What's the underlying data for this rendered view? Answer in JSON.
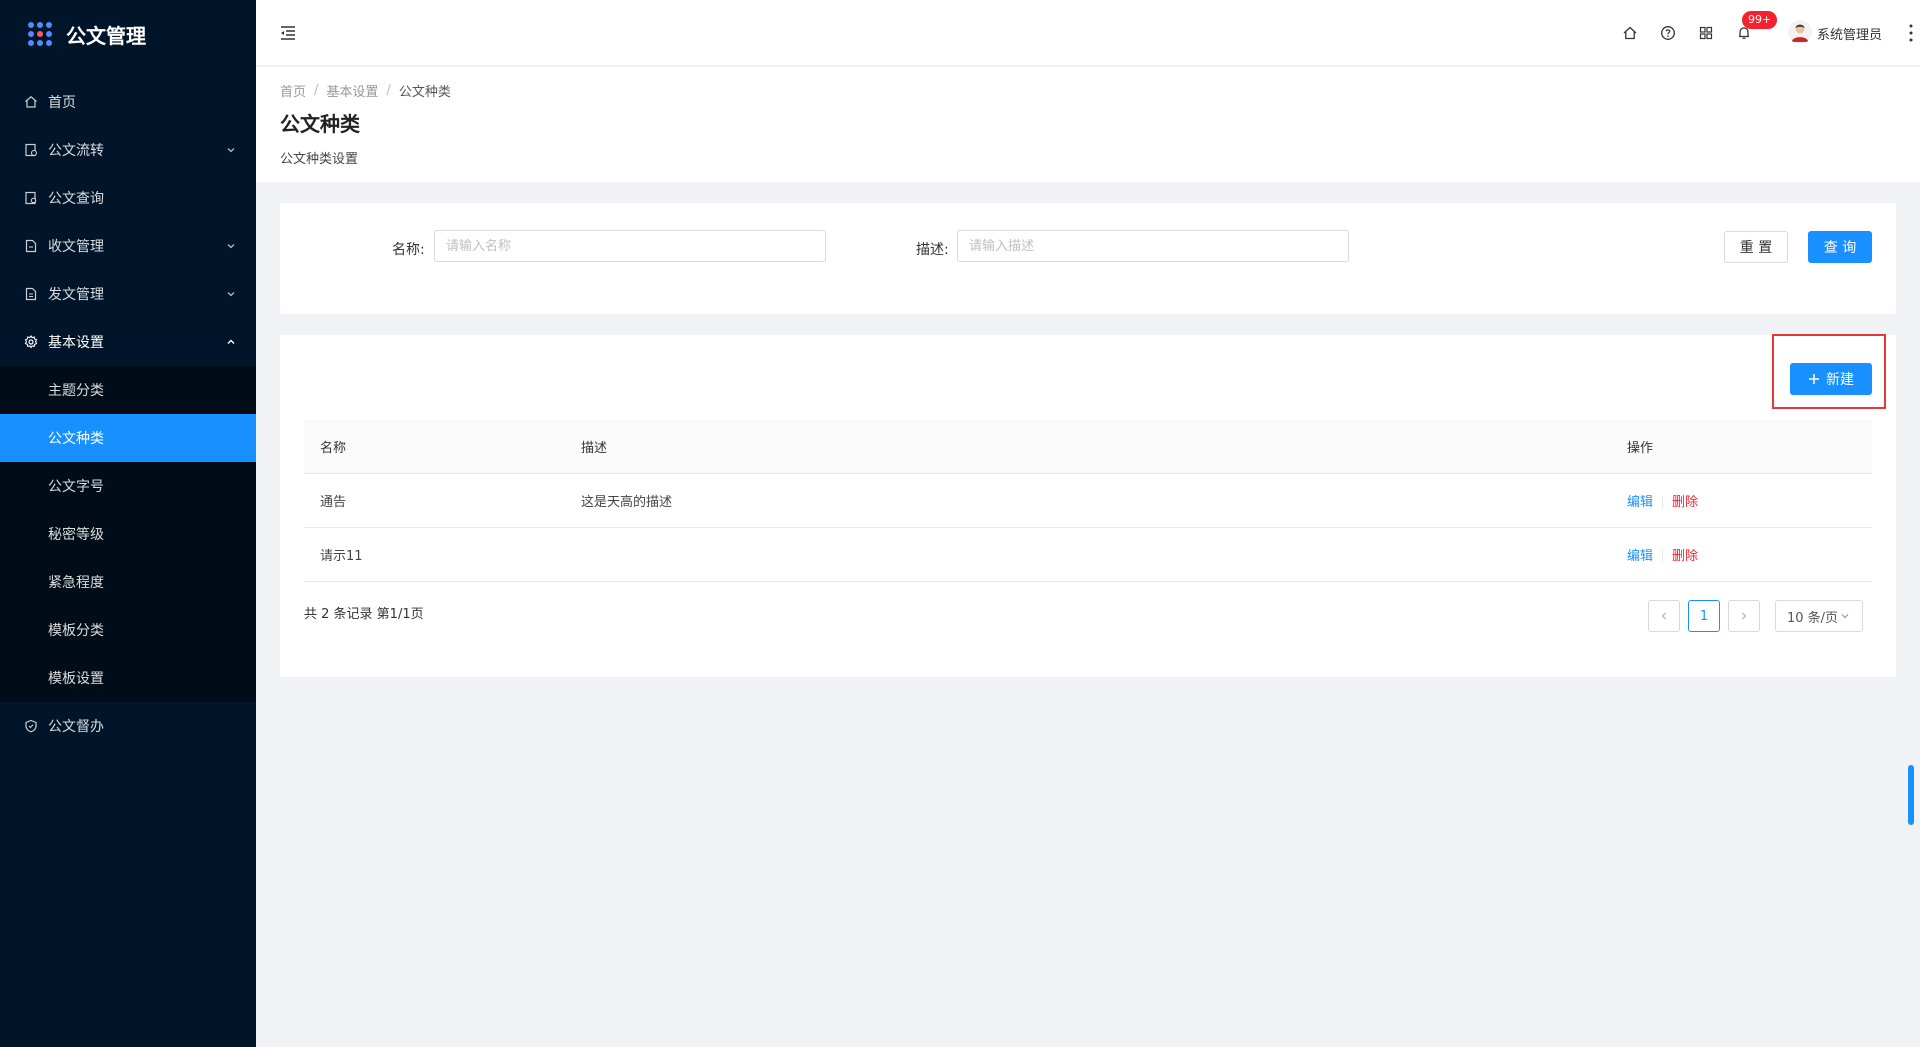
{
  "app": {
    "title": "公文管理"
  },
  "sidebar": {
    "items": [
      {
        "label": "首页",
        "icon": "home-icon"
      },
      {
        "label": "公文流转",
        "icon": "flow-icon",
        "expandable": true
      },
      {
        "label": "公文查询",
        "icon": "search-doc-icon"
      },
      {
        "label": "收文管理",
        "icon": "file-in-icon",
        "expandable": true
      },
      {
        "label": "发文管理",
        "icon": "file-out-icon",
        "expandable": true
      },
      {
        "label": "基本设置",
        "icon": "gear-icon",
        "expandable": true,
        "open": true
      }
    ],
    "submenu": [
      {
        "label": "主题分类"
      },
      {
        "label": "公文种类",
        "active": true
      },
      {
        "label": "公文字号"
      },
      {
        "label": "秘密等级"
      },
      {
        "label": "紧急程度"
      },
      {
        "label": "模板分类"
      },
      {
        "label": "模板设置"
      }
    ],
    "after": [
      {
        "label": "公文督办",
        "icon": "supervise-icon"
      }
    ]
  },
  "header": {
    "badge": "99+",
    "user_name": "系统管理员"
  },
  "breadcrumb": [
    "首页",
    "基本设置",
    "公文种类"
  ],
  "page": {
    "title": "公文种类",
    "description": "公文种类设置"
  },
  "search": {
    "name_label": "名称:",
    "name_placeholder": "请输入名称",
    "desc_label": "描述:",
    "desc_placeholder": "请输入描述",
    "reset_label": "重 置",
    "query_label": "查 询"
  },
  "toolbar": {
    "new_label": "新建"
  },
  "table": {
    "columns": [
      "名称",
      "描述",
      "操作"
    ],
    "rows": [
      {
        "name": "通告",
        "desc": "这是天高的描述",
        "edit": "编辑",
        "delete": "删除"
      },
      {
        "name": "请示11",
        "desc": "",
        "edit": "编辑",
        "delete": "删除"
      }
    ]
  },
  "pagination": {
    "total_text": "共 2 条记录 第1/1页",
    "current_page": "1",
    "page_size": "10 条/页"
  },
  "colors": {
    "primary": "#1890ff",
    "danger": "#f5222d",
    "sidebar_bg": "#001529"
  }
}
